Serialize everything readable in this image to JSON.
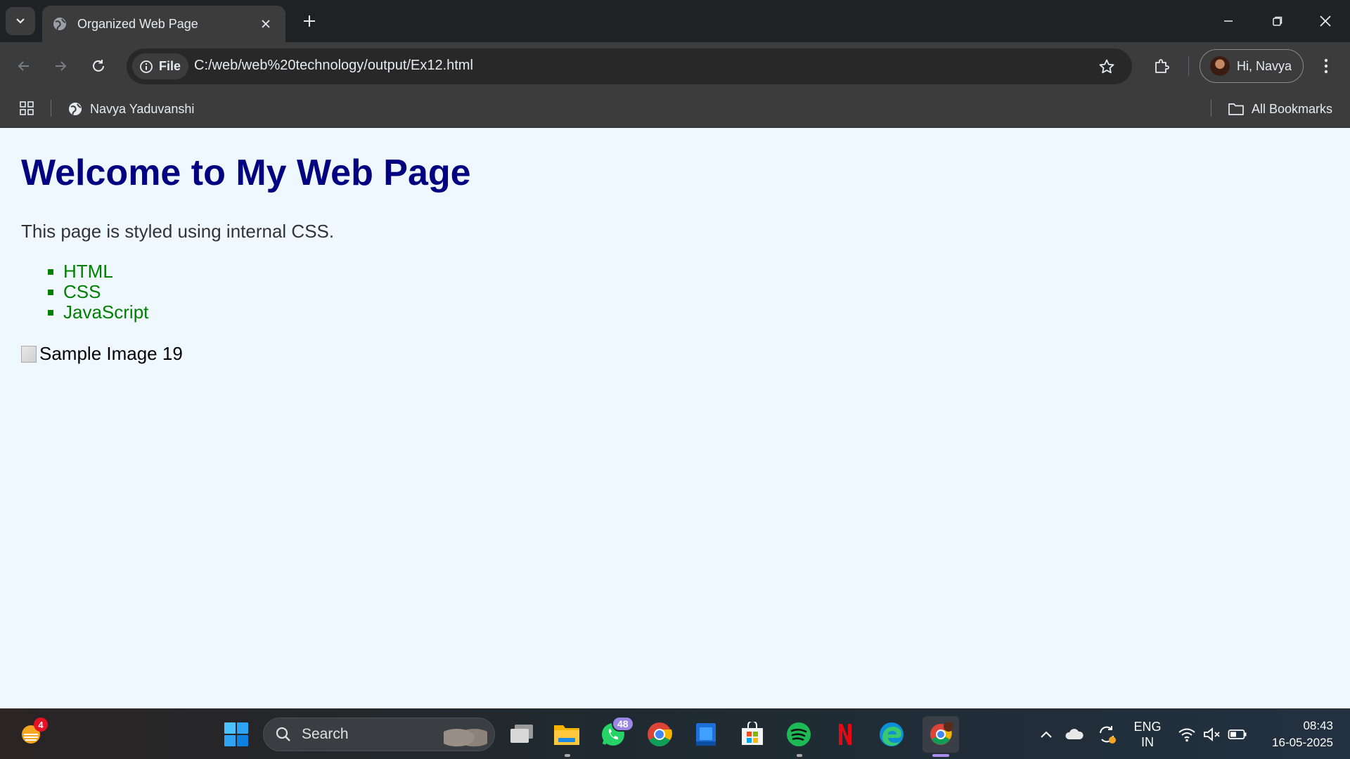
{
  "browser": {
    "tab_title": "Organized Web Page",
    "site_chip": "File",
    "url": "C:/web/web%20technology/output/Ex12.html",
    "profile_name": "Hi, Navya",
    "bookmark": "Navya Yaduvanshi",
    "all_bookmarks": "All Bookmarks"
  },
  "page": {
    "heading": "Welcome to My Web Page",
    "paragraph": "This page is styled using internal CSS.",
    "list_items": [
      "HTML",
      "CSS",
      "JavaScript"
    ],
    "image_alt": "Sample Image 19",
    "colors": {
      "background": "#f0f8ff",
      "heading": "#000080",
      "list": "#008000"
    }
  },
  "taskbar": {
    "search_placeholder": "Search",
    "weather_badge": "4",
    "whatsapp_badge": "48",
    "language": "ENG",
    "region": "IN",
    "time": "08:43",
    "date": "16-05-2025",
    "apps": [
      "start-icon",
      "task-view-icon",
      "file-explorer-icon",
      "whatsapp-icon",
      "chrome-icon",
      "store-app-icon",
      "microsoft-store-icon",
      "spotify-icon",
      "netflix-icon",
      "edge-icon",
      "chrome-profile-icon"
    ]
  }
}
